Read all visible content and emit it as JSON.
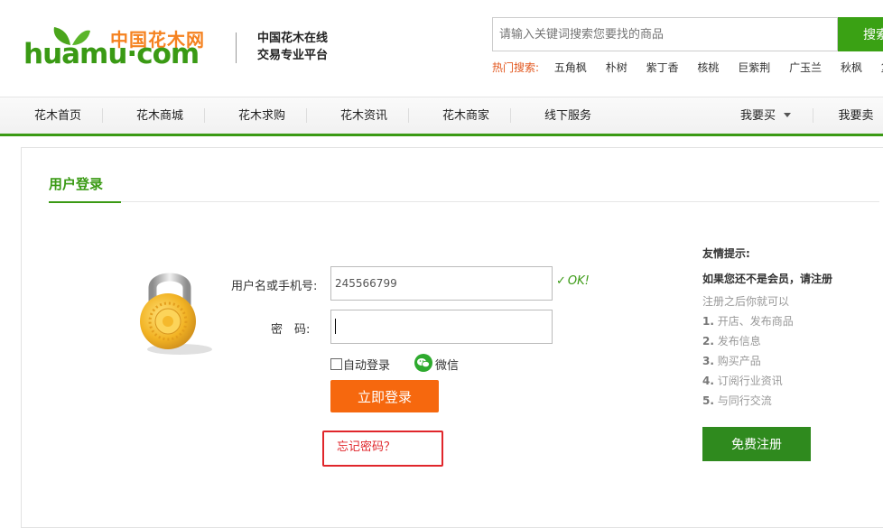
{
  "header": {
    "logo_cn": "中国花木网",
    "logo_en": "huamu·com",
    "slogan_line1": "中国花木在线",
    "slogan_line2": "交易专业平台"
  },
  "search": {
    "placeholder": "请输入关键词搜索您要找的商品",
    "button_label": "搜索",
    "hot_label": "热门搜索:",
    "hot_keywords": [
      "五角枫",
      "朴树",
      "紫丁香",
      "核桃",
      "巨紫荆",
      "广玉兰",
      "秋枫",
      "复"
    ]
  },
  "nav": {
    "items": [
      "花木首页",
      "花木商城",
      "花木求购",
      "花木资讯",
      "花木商家",
      "线下服务"
    ],
    "buy_label": "我要买",
    "sell_label": "我要卖"
  },
  "login": {
    "title": "用户登录",
    "username_label": "用户名或手机号:",
    "username_value": "245566799",
    "password_label": "密　码:",
    "ok_text": "OK!",
    "auto_login_label": "自动登录",
    "wechat_label": "微信",
    "submit_label": "立即登录",
    "forgot_label": "忘记密码？"
  },
  "tips": {
    "title": "友情提示:",
    "subtitle": "如果您还不是会员，请注册",
    "intro": "注册之后你就可以",
    "items": [
      {
        "num": "1.",
        "text": "开店、发布商品"
      },
      {
        "num": "2.",
        "text": "发布信息"
      },
      {
        "num": "3.",
        "text": "购买产品"
      },
      {
        "num": "4.",
        "text": "订阅行业资讯"
      },
      {
        "num": "5.",
        "text": "与同行交流"
      }
    ],
    "register_label": "免费注册"
  },
  "colors": {
    "brand_green": "#3a9a14",
    "brand_orange": "#f58220",
    "login_button": "#f6680e",
    "register_button": "#2f8a1e",
    "highlight_red": "#e0262b"
  }
}
